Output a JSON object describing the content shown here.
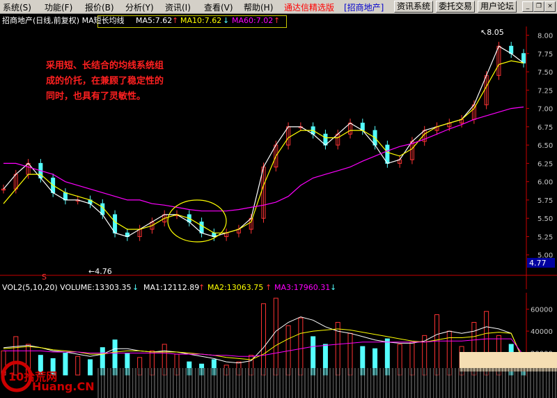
{
  "menu": {
    "items": [
      "系统(S)",
      "功能(F)",
      "报价(B)",
      "分析(Y)",
      "资讯(I)",
      "查看(V)",
      "帮助(H)"
    ],
    "app_title": "通达信精选版",
    "stock_tag": "[招商地产]",
    "buttons": [
      "资讯系统",
      "委托交易",
      "用户论坛"
    ]
  },
  "price_panel": {
    "title": "招商地产(日线,前复权) MA短长均线",
    "ma5": "MA5:7.62",
    "ma10": "MA10:7.62",
    "ma60": "MA60:7.02",
    "annotation": [
      "采用短、长结合的均线系统组",
      "成的价托，在兼顾了稳定性的",
      "同时，也具有了灵敏性。"
    ],
    "high_label": "8.05",
    "low_label": "4.76",
    "current_price": "4.77",
    "s_marker": "S"
  },
  "volume_panel": {
    "label": "VOL2(5,10,20) VOLUME:13303.35",
    "ma1": "MA1:12112.89",
    "ma2": "MA2:13063.75",
    "ma3": "MA3:17960.31"
  },
  "watermark": {
    "brand": "10拾荒网",
    "url": "Huang.CN"
  },
  "colors": {
    "up": "#ff3333",
    "down": "#54ffff",
    "ma_white": "#ffffff",
    "ma_yellow": "#ffff00",
    "ma_magenta": "#ff00ff",
    "axis": "#c80000",
    "annotation": "#ff2020",
    "ellipse": "#ffff00"
  },
  "chart_data": [
    {
      "type": "candlestick",
      "title": "招商地产(日线,前复权) MA短长均线",
      "y_ticks": [
        5.0,
        5.25,
        5.5,
        5.75,
        6.0,
        6.25,
        6.5,
        6.75,
        7.0,
        7.25,
        7.5,
        7.75,
        8.0
      ],
      "ylim": [
        4.75,
        8.1
      ],
      "series": [
        {
          "name": "MA5",
          "values": [
            5.9,
            6.1,
            6.25,
            6.05,
            5.85,
            5.75,
            5.75,
            5.7,
            5.55,
            5.3,
            5.25,
            5.35,
            5.45,
            5.55,
            5.55,
            5.45,
            5.3,
            5.25,
            5.3,
            5.35,
            5.5,
            6.2,
            6.5,
            6.75,
            6.75,
            6.65,
            6.5,
            6.65,
            6.8,
            6.7,
            6.5,
            6.25,
            6.3,
            6.55,
            6.7,
            6.75,
            6.8,
            6.85,
            7.05,
            7.45,
            7.85,
            7.75,
            7.62
          ]
        },
        {
          "name": "MA10",
          "values": [
            5.7,
            5.9,
            6.1,
            6.1,
            5.95,
            5.85,
            5.8,
            5.75,
            5.65,
            5.45,
            5.35,
            5.35,
            5.4,
            5.5,
            5.55,
            5.5,
            5.4,
            5.3,
            5.3,
            5.35,
            5.45,
            5.95,
            6.35,
            6.6,
            6.7,
            6.7,
            6.6,
            6.6,
            6.7,
            6.7,
            6.6,
            6.4,
            6.35,
            6.45,
            6.65,
            6.75,
            6.8,
            6.85,
            7.0,
            7.3,
            7.6,
            7.65,
            7.62
          ]
        },
        {
          "name": "MA60",
          "values": [
            6.25,
            6.25,
            6.2,
            6.15,
            6.1,
            6.0,
            5.95,
            5.9,
            5.85,
            5.8,
            5.75,
            5.75,
            5.7,
            5.68,
            5.65,
            5.62,
            5.6,
            5.6,
            5.6,
            5.62,
            5.65,
            5.68,
            5.72,
            5.8,
            5.95,
            6.05,
            6.1,
            6.15,
            6.2,
            6.28,
            6.35,
            6.42,
            6.48,
            6.52,
            6.58,
            6.65,
            6.72,
            6.78,
            6.85,
            6.9,
            6.95,
            7.0,
            7.02
          ]
        }
      ],
      "annotations": {
        "high": 8.05,
        "low": 4.76,
        "current": 4.77
      }
    },
    {
      "type": "bar",
      "title": "VOL2(5,10,20)",
      "y_ticks": [
        20000,
        40000,
        60000
      ],
      "ylim": [
        0,
        75000
      ],
      "series": [
        {
          "name": "VOLUME",
          "values": [
            22000,
            35000,
            28000,
            18000,
            15000,
            20000,
            17000,
            14000,
            25000,
            32000,
            20000,
            16000,
            22000,
            28000,
            19000,
            12000,
            10000,
            14000,
            9000,
            12000,
            18000,
            65000,
            70000,
            45000,
            52000,
            35000,
            28000,
            48000,
            38000,
            26000,
            24000,
            33000,
            28000,
            30000,
            36000,
            55000,
            40000,
            26000,
            48000,
            58000,
            36000,
            28000,
            13303
          ]
        },
        {
          "name": "MA1",
          "values": [
            25000,
            26000,
            27000,
            25000,
            22000,
            21000,
            19000,
            17000,
            19000,
            24000,
            24000,
            22000,
            21000,
            22000,
            21000,
            19000,
            17000,
            15000,
            12000,
            11000,
            13000,
            25000,
            40000,
            48000,
            53000,
            50000,
            44000,
            40000,
            38000,
            35000,
            32000,
            30000,
            29000,
            29000,
            31000,
            37000,
            40000,
            38000,
            40000,
            44000,
            42000,
            38000,
            12113
          ]
        },
        {
          "name": "MA2",
          "values": [
            24000,
            25000,
            26000,
            25000,
            23000,
            22000,
            21000,
            19000,
            19000,
            21000,
            22000,
            22000,
            21000,
            21000,
            21000,
            20000,
            19000,
            18000,
            16000,
            15000,
            14000,
            19000,
            27000,
            33000,
            38000,
            40000,
            41000,
            42000,
            41000,
            39000,
            37000,
            35000,
            33000,
            31000,
            30000,
            32000,
            34000,
            34000,
            35000,
            38000,
            39000,
            38000,
            13064
          ]
        },
        {
          "name": "MA3",
          "values": [
            22000,
            22000,
            22000,
            22000,
            21000,
            21000,
            21000,
            20000,
            20000,
            20000,
            20000,
            20000,
            20000,
            20000,
            19000,
            19000,
            19000,
            18000,
            18000,
            17000,
            17000,
            18000,
            20000,
            22000,
            24000,
            26000,
            27000,
            28000,
            29000,
            30000,
            30000,
            30000,
            30000,
            30000,
            30000,
            31000,
            31000,
            31000,
            32000,
            33000,
            33000,
            33000,
            17960
          ]
        }
      ]
    }
  ]
}
